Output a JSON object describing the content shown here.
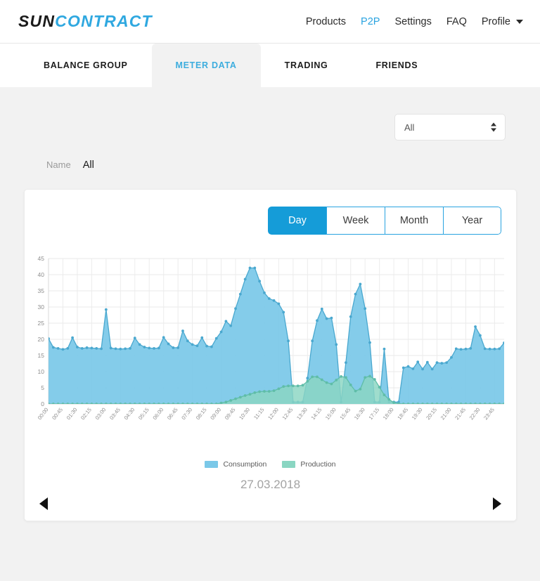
{
  "header": {
    "logo_part1": "SUN",
    "logo_part2": "CONTRACT",
    "nav": [
      {
        "label": "Products",
        "active": false
      },
      {
        "label": "P2P",
        "active": true
      },
      {
        "label": "Settings",
        "active": false
      },
      {
        "label": "FAQ",
        "active": false
      },
      {
        "label": "Profile",
        "active": false
      }
    ]
  },
  "tabs": [
    {
      "label": "BALANCE GROUP",
      "active": false
    },
    {
      "label": "METER DATA",
      "active": true
    },
    {
      "label": "TRADING",
      "active": false
    },
    {
      "label": "FRIENDS",
      "active": false
    }
  ],
  "filters": {
    "meter_select_value": "All",
    "meter_select_options": [
      "All"
    ],
    "name_label": "Name",
    "name_value": "All"
  },
  "chart_card": {
    "ranges": [
      {
        "label": "Day",
        "active": true
      },
      {
        "label": "Week",
        "active": false
      },
      {
        "label": "Month",
        "active": false
      },
      {
        "label": "Year",
        "active": false
      }
    ],
    "date": "27.03.2018",
    "prev_arrow": "◀",
    "next_arrow": "▶"
  },
  "colors": {
    "accent": "#29a3e0",
    "active_button": "#159cd8",
    "consumption": "#7ac8e8",
    "consumption_line": "#4aa8cf",
    "production": "#8ad6c2",
    "production_line": "#5fbda8",
    "page_bg": "#f2f2f2",
    "tab_active_text": "#3dadde"
  },
  "chart_data": {
    "type": "area",
    "title": "",
    "xlabel": "",
    "ylabel": "",
    "ylim": [
      0,
      45
    ],
    "yticks": [
      0,
      5,
      10,
      15,
      20,
      25,
      30,
      35,
      40,
      45
    ],
    "grid": true,
    "legend_position": "bottom",
    "tick_labels": [
      "00:00",
      "00:45",
      "01:30",
      "02:15",
      "03:00",
      "03:45",
      "04:30",
      "05:15",
      "06:00",
      "06:45",
      "07:30",
      "08:15",
      "09:00",
      "09:45",
      "10:30",
      "11:15",
      "12:00",
      "12:45",
      "13:30",
      "14:15",
      "15:00",
      "15:45",
      "16:30",
      "17:15",
      "18:00",
      "18:45",
      "19:30",
      "20:15",
      "21:00",
      "21:45",
      "22:30",
      "23:45"
    ],
    "x": [
      "00:00",
      "00:15",
      "00:30",
      "00:45",
      "01:00",
      "01:15",
      "01:30",
      "01:45",
      "02:00",
      "02:15",
      "02:30",
      "02:45",
      "03:00",
      "03:15",
      "03:30",
      "03:45",
      "04:00",
      "04:15",
      "04:30",
      "04:45",
      "05:00",
      "05:15",
      "05:30",
      "05:45",
      "06:00",
      "06:15",
      "06:30",
      "06:45",
      "07:00",
      "07:15",
      "07:30",
      "07:45",
      "08:00",
      "08:15",
      "08:30",
      "08:45",
      "09:00",
      "09:15",
      "09:30",
      "09:45",
      "10:00",
      "10:15",
      "10:30",
      "10:45",
      "11:00",
      "11:15",
      "11:30",
      "11:45",
      "12:00",
      "12:15",
      "12:30",
      "12:45",
      "13:00",
      "13:15",
      "13:30",
      "13:45",
      "14:00",
      "14:15",
      "14:30",
      "14:45",
      "15:00",
      "15:15",
      "15:30",
      "15:45",
      "16:00",
      "16:15",
      "16:30",
      "16:45",
      "17:00",
      "17:15",
      "17:30",
      "17:45",
      "18:00",
      "18:15",
      "18:30",
      "18:45",
      "19:00",
      "19:15",
      "19:30",
      "19:45",
      "20:00",
      "20:15",
      "20:30",
      "20:45",
      "21:00",
      "21:15",
      "21:30",
      "21:45",
      "22:00",
      "22:15",
      "22:30",
      "22:45",
      "23:00",
      "23:15",
      "23:30",
      "23:45"
    ],
    "series": [
      {
        "name": "Consumption",
        "color": "#7ac8e8",
        "values": [
          20.2,
          17.5,
          17.2,
          16.9,
          17.2,
          20.5,
          17.6,
          17.2,
          17.4,
          17.3,
          17.2,
          17.1,
          29.2,
          17.3,
          17.1,
          17.0,
          17.1,
          17.2,
          20.4,
          18.4,
          17.6,
          17.3,
          17.2,
          17.3,
          20.6,
          18.6,
          17.4,
          17.4,
          22.6,
          19.5,
          18.4,
          18.0,
          20.5,
          17.9,
          17.7,
          20.3,
          22.3,
          25.6,
          24.2,
          29.5,
          34.0,
          38.6,
          42.1,
          42.1,
          38.0,
          34.4,
          32.6,
          32.0,
          31.0,
          28.4,
          19.5,
          0.6,
          0.6,
          0.6,
          8.0,
          19.5,
          25.8,
          29.4,
          26.4,
          26.6,
          18.4,
          0.6,
          12.8,
          27.0,
          34.0,
          37.1,
          29.5,
          19.0,
          0.6,
          0.6,
          17.0,
          0.6,
          0.6,
          0.6,
          11.2,
          11.6,
          10.9,
          13.0,
          10.8,
          12.9,
          10.8,
          12.8,
          12.6,
          12.8,
          14.4,
          17.1,
          16.9,
          17.0,
          17.2,
          23.9,
          21.2,
          17.1,
          17.0,
          17.0,
          17.1,
          18.9
        ]
      },
      {
        "name": "Production",
        "color": "#8ad6c2",
        "values": [
          0,
          0,
          0,
          0,
          0,
          0,
          0,
          0,
          0,
          0,
          0,
          0,
          0,
          0,
          0,
          0,
          0,
          0,
          0,
          0,
          0,
          0,
          0,
          0,
          0,
          0,
          0,
          0,
          0,
          0,
          0,
          0,
          0,
          0,
          0,
          0,
          0.3,
          0.6,
          1.1,
          1.6,
          2.1,
          2.6,
          3.0,
          3.5,
          3.8,
          3.9,
          3.9,
          4.1,
          4.7,
          5.4,
          5.6,
          5.6,
          5.6,
          5.8,
          7.0,
          8.4,
          8.4,
          7.5,
          6.6,
          6.2,
          7.4,
          8.5,
          8.2,
          5.9,
          4.0,
          4.6,
          8.2,
          8.6,
          7.6,
          5.2,
          2.8,
          1.4,
          0.4,
          0.1,
          0,
          0,
          0,
          0,
          0,
          0,
          0,
          0,
          0,
          0,
          0,
          0,
          0,
          0,
          0,
          0,
          0,
          0,
          0,
          0,
          0,
          0
        ]
      }
    ],
    "legend": [
      {
        "label": "Consumption",
        "color": "#7ac8e8"
      },
      {
        "label": "Production",
        "color": "#8ad6c2"
      }
    ]
  }
}
